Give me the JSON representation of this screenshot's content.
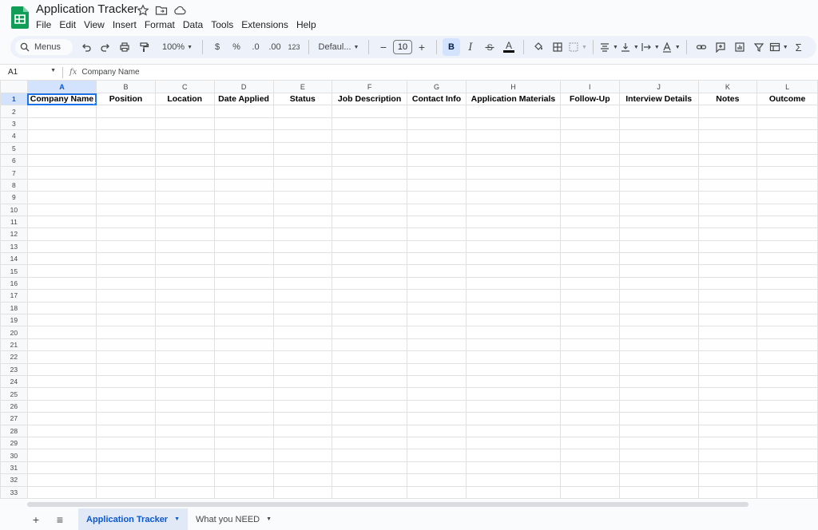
{
  "app": {
    "title": "Application Tracker"
  },
  "menu": [
    "File",
    "Edit",
    "View",
    "Insert",
    "Format",
    "Data",
    "Tools",
    "Extensions",
    "Help"
  ],
  "toolbar": {
    "search_label": "Menus",
    "zoom": "100%",
    "currency": "$",
    "percent": "%",
    "decrease_decimal": ".0",
    "increase_decimal": ".00",
    "number_format": "123",
    "font": "Defaul...",
    "font_size": "10",
    "bold": "B",
    "italic": "I",
    "text_color": "A"
  },
  "formula_bar": {
    "cell_ref": "A1",
    "fx": "fx",
    "content": "Company Name"
  },
  "columns": [
    "A",
    "B",
    "C",
    "D",
    "E",
    "F",
    "G",
    "H",
    "I",
    "J",
    "K",
    "L"
  ],
  "headers": [
    "Company Name",
    "Position",
    "Location",
    "Date Applied",
    "Status",
    "Job Description",
    "Contact Info",
    "Application Materials",
    "Follow-Up",
    "Interview Details",
    "Notes",
    "Outcome"
  ],
  "rows": [
    "1",
    "2",
    "3",
    "4",
    "5",
    "6",
    "7",
    "8",
    "9",
    "10",
    "11",
    "12",
    "13",
    "14",
    "15",
    "16",
    "17",
    "18",
    "19",
    "20",
    "21",
    "22",
    "23",
    "24",
    "25",
    "26",
    "27",
    "28",
    "29",
    "30",
    "31",
    "32",
    "33"
  ],
  "sheets": [
    {
      "label": "Application Tracker",
      "active": true
    },
    {
      "label": "What you NEED",
      "active": false
    }
  ],
  "colors": {
    "accent": "#1a73e8",
    "sheets_green": "#0f9d58",
    "toolbar_bg": "#edf2fa"
  }
}
